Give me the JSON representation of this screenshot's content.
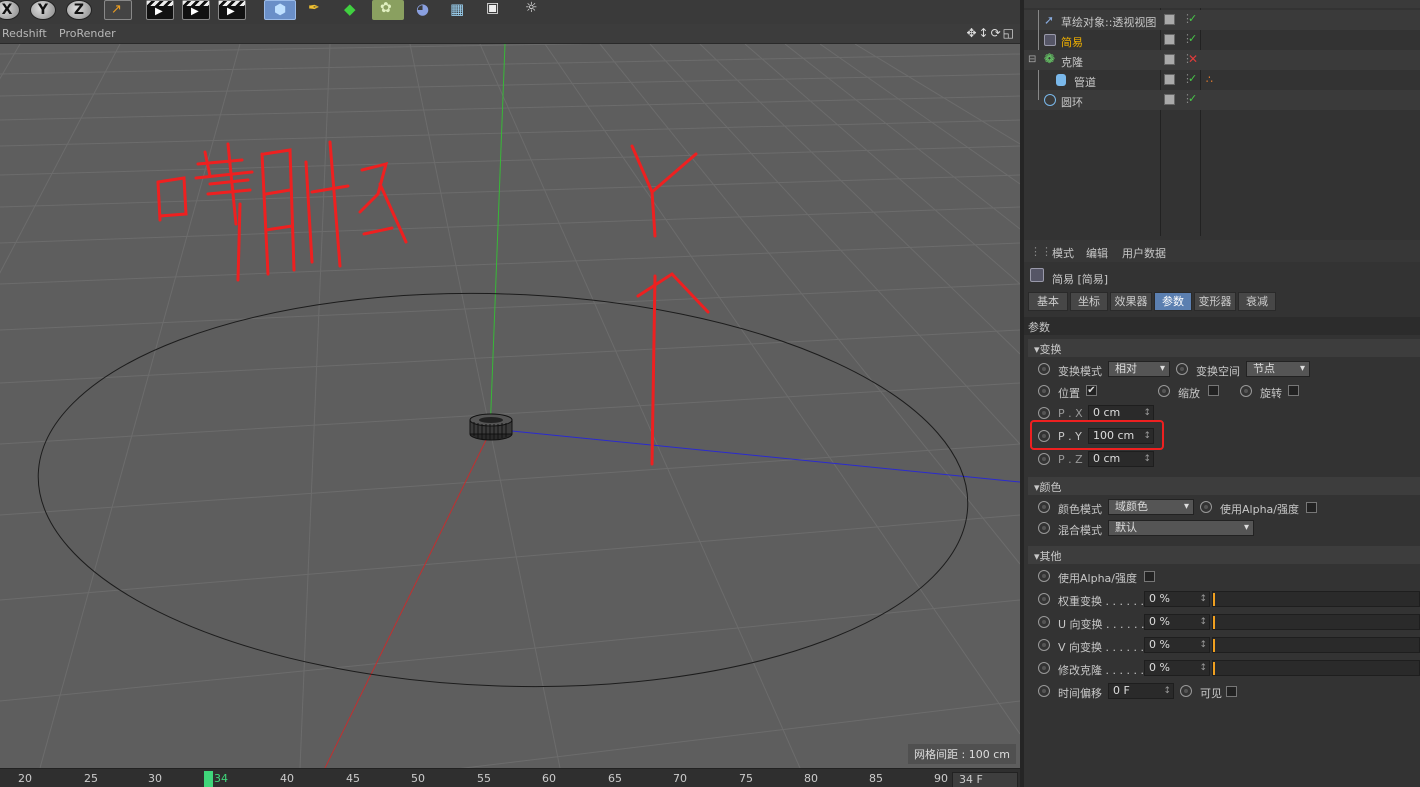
{
  "toolbar": {
    "axis_buttons": [
      "X",
      "Y",
      "Z"
    ]
  },
  "viewport": {
    "menus": [
      "Redshift",
      "ProRender"
    ],
    "grid_spacing": "网格间距 : 100 cm",
    "annotation_text_left": "哼朝外",
    "annotation_text_right": "Y",
    "colors": {
      "background": "#5e5e5e",
      "y_axis": "#38b838",
      "x_axis": "#c03030",
      "z_axis": "#2a2ad0",
      "annotation": "#ee2020"
    }
  },
  "timeline": {
    "ticks": [
      "20",
      "25",
      "30",
      "34",
      "40",
      "45",
      "50",
      "55",
      "60",
      "65",
      "70",
      "75",
      "80",
      "85",
      "90"
    ],
    "current_frame": "34 F"
  },
  "objects": [
    {
      "name": "草绘对象::透视视图",
      "icon": "sketch-icon",
      "selected": false,
      "status": "ok"
    },
    {
      "name": "简易",
      "icon": "effector-icon",
      "selected": true,
      "status": "ok"
    },
    {
      "name": "克隆",
      "icon": "cloner-icon",
      "selected": false,
      "status": "off"
    },
    {
      "name": "管道",
      "icon": "tube-icon",
      "selected": false,
      "status": "ok"
    },
    {
      "name": "圆环",
      "icon": "circle-icon",
      "selected": false,
      "status": "ok"
    }
  ],
  "attributes": {
    "menu": [
      "模式",
      "编辑",
      "用户数据"
    ],
    "object_title": "简易 [简易]",
    "tabs": [
      "基本",
      "坐标",
      "效果器",
      "参数",
      "变形器",
      "衰减"
    ],
    "active_tab": "参数",
    "section": "参数",
    "transform": {
      "header": "变换",
      "mode_label": "变换模式",
      "mode_value": "相对",
      "space_label": "变换空间",
      "space_value": "节点",
      "position_label": "位置",
      "position_checked": "✔",
      "scale_label": "缩放",
      "rotate_label": "旋转",
      "px_label": "P . X",
      "px_value": "0 cm",
      "py_label": "P . Y",
      "py_value": "100 cm",
      "pz_label": "P . Z",
      "pz_value": "0 cm"
    },
    "color": {
      "header": "颜色",
      "mode_label": "颜色模式",
      "mode_value": "域颜色",
      "alpha_label": "使用Alpha/强度",
      "blend_label": "混合模式",
      "blend_value": "默认"
    },
    "other": {
      "header": "其他",
      "alpha_label": "使用Alpha/强度",
      "weight_label": "权重变换 . . . . . .",
      "weight_value": "0 %",
      "u_label": "U 向变换 . . . . . .",
      "u_value": "0 %",
      "v_label": "V 向变换 . . . . . .",
      "v_value": "0 %",
      "clone_label": "修改克隆 . . . . . .",
      "clone_value": "0 %",
      "time_label": "时间偏移",
      "time_value": "0 F",
      "visible_label": "可见"
    }
  }
}
